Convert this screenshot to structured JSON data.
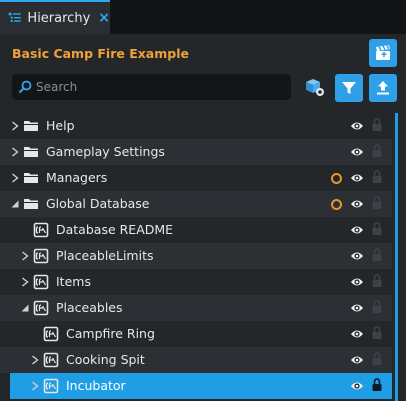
{
  "tab": {
    "title": "Hierarchy",
    "close": "×"
  },
  "panel": {
    "title": "Basic Camp Fire Example"
  },
  "search": {
    "placeholder": "Search",
    "value": ""
  },
  "colors": {
    "accent": "#2fa0e8",
    "title": "#f0a23a",
    "warning_dot": "#e8942a",
    "selection": "#1f9ee6"
  },
  "icons": [
    "hierarchy-icon",
    "clapperboard-icon",
    "cube-icon",
    "filter-icon",
    "upload-icon",
    "search-icon",
    "folder-icon",
    "script-icon",
    "eye-icon",
    "lock-icon"
  ],
  "tree": [
    {
      "label": "Help",
      "icon": "folder",
      "depth": 0,
      "arrow": "collapsed",
      "dot": false,
      "locked_visible": true,
      "selected": false
    },
    {
      "label": "Gameplay Settings",
      "icon": "folder",
      "depth": 0,
      "arrow": "collapsed",
      "dot": false,
      "locked_visible": true,
      "selected": false
    },
    {
      "label": "Managers",
      "icon": "folder",
      "depth": 0,
      "arrow": "collapsed",
      "dot": true,
      "locked_visible": true,
      "selected": false
    },
    {
      "label": "Global Database",
      "icon": "folder",
      "depth": 0,
      "arrow": "expanded",
      "dot": true,
      "locked_visible": true,
      "selected": false
    },
    {
      "label": "Database README",
      "icon": "script",
      "depth": 1,
      "arrow": "none",
      "dot": false,
      "locked_visible": true,
      "selected": false
    },
    {
      "label": "PlaceableLimits",
      "icon": "script",
      "depth": 1,
      "arrow": "collapsed",
      "dot": false,
      "locked_visible": true,
      "selected": false
    },
    {
      "label": "Items",
      "icon": "script",
      "depth": 1,
      "arrow": "collapsed",
      "dot": false,
      "locked_visible": true,
      "selected": false
    },
    {
      "label": "Placeables",
      "icon": "script",
      "depth": 1,
      "arrow": "expanded",
      "dot": false,
      "locked_visible": true,
      "selected": false
    },
    {
      "label": "Campfire Ring",
      "icon": "script",
      "depth": 2,
      "arrow": "none",
      "dot": false,
      "locked_visible": true,
      "selected": false
    },
    {
      "label": "Cooking Spit",
      "icon": "script",
      "depth": 2,
      "arrow": "collapsed",
      "dot": false,
      "locked_visible": true,
      "selected": false
    },
    {
      "label": "Incubator",
      "icon": "script",
      "depth": 2,
      "arrow": "collapsed",
      "dot": false,
      "locked_visible": true,
      "selected": true
    }
  ]
}
